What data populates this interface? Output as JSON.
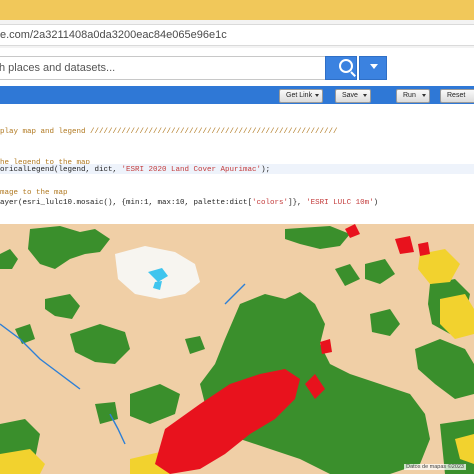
{
  "browser": {
    "url": "e.com/2a3211408a0da3200eac84e065e96e1c"
  },
  "search": {
    "placeholder": "h places and datasets..."
  },
  "toolbar": {
    "get_link": "Get Link",
    "save": "Save",
    "run": "Run",
    "reset": "Reset"
  },
  "code": {
    "line1": "play map and legend ///////////////////////////////////////////////////////",
    "line2": "he legend to the map",
    "line3_pre": "oricalLegend(legend, dict, ",
    "line3_str": "'ESRI 2020 Land Cover Apurimac'",
    "line3_post": ");",
    "line4": "mage to the map",
    "line5_pre": "ayer(esri_lulc10.mosaic(), {min:1, max:10, palette:dict[",
    "line5_str1": "'colors'",
    "line5_mid": "]}, ",
    "line5_str2": "'ESRI LULC 10m'",
    "line5_post": ")"
  },
  "map": {
    "attribution": "Datos de mapas ©2023",
    "colors": {
      "bare": "#f0cfa6",
      "trees": "#3a8f2c",
      "built": "#e8121d",
      "crops": "#f2d22e",
      "snow": "#ffffff",
      "water": "#2d7fd6"
    }
  }
}
